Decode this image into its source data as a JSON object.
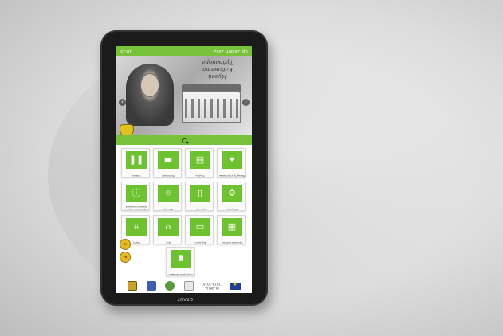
{
  "statusbar": {
    "time": "10:25",
    "date": "Ср, 26 окт. 2022"
  },
  "hero": {
    "title_line1": "Музей",
    "title_line2": "Кабинета Тудронора"
  },
  "tiles": [
    {
      "icon": "info-icon",
      "glyph": "❚❚",
      "label": "Главное"
    },
    {
      "icon": "cart-icon",
      "glyph": "▬",
      "label": "Экспозиция"
    },
    {
      "icon": "archive-icon",
      "glyph": "▤",
      "label": "Ресурсы"
    },
    {
      "icon": "people-icon",
      "glyph": "✦",
      "label": "Маршруты и программы"
    },
    {
      "icon": "info-circle-icon",
      "glyph": "ⓘ",
      "label": "Информация о музее и правила посещения"
    },
    {
      "icon": "location-icon",
      "glyph": "⌾",
      "label": "Маршрут"
    },
    {
      "icon": "bag-icon",
      "glyph": "▯",
      "label": "Сувениры"
    },
    {
      "icon": "gear-people-icon",
      "glyph": "⚙",
      "label": "Экскурсии"
    },
    {
      "icon": "map-icon",
      "glyph": "⌗",
      "label": "Карта"
    },
    {
      "icon": "house-icon",
      "glyph": "⌂",
      "label": "Дом"
    },
    {
      "icon": "document-icon",
      "glyph": "▭",
      "label": "Документы"
    },
    {
      "icon": "building-icon",
      "glyph": "▦",
      "label": "Музейный комплекс"
    }
  ],
  "side_buttons": [
    {
      "label": "BY"
    },
    {
      "label": "EN"
    }
  ],
  "bottom_tile": {
    "icon": "crest-icon",
    "glyph": "♜",
    "label": "Культурное наследие"
  },
  "footer": {
    "program_text_line1": "PL-BY-UA",
    "program_text_line2": "2014-2020"
  },
  "kiosk": {
    "brand": "GRANT"
  },
  "colors": {
    "brand_green": "#78c23a",
    "tile_green": "#6ec12f",
    "bezel": "#1b1b1b"
  }
}
